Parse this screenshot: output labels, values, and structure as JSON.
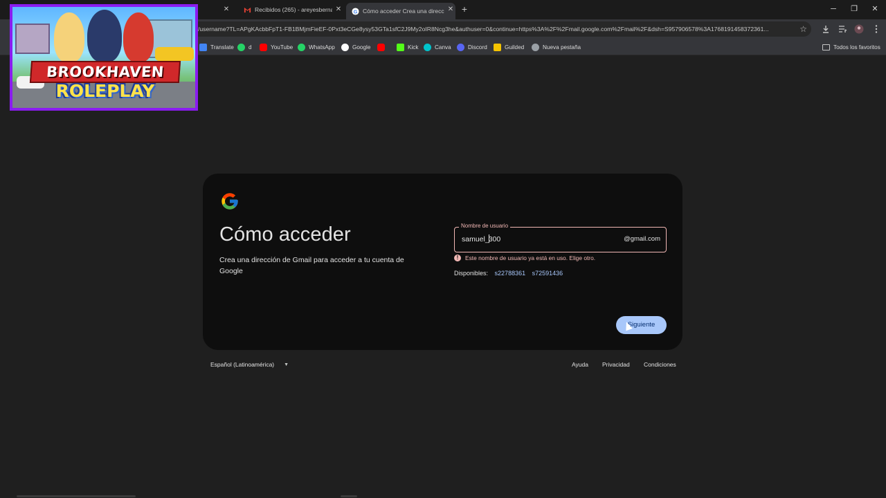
{
  "browser": {
    "tabs": [
      {
        "title": "",
        "active": false
      },
      {
        "title": "Recibidos (265) - areyesbernan",
        "active": false,
        "icon": "gmail-icon"
      },
      {
        "title": "Cómo acceder Crea una direcci",
        "active": true,
        "icon": "google-icon"
      }
    ],
    "url": "/username?TL=APgKAcbbFpT1-FB1BMjmFieEF-0Pxt3eCGe8ysy53GTa1sfC2J9My2oIR8Ncg3he&authuser=0&continue=https%3A%2F%2Fmail.google.com%2Fmail%2F&dsh=S957906578%3A1768191458372361...",
    "bookmarks": [
      {
        "label": "Translate",
        "icon": "translate-icon",
        "color": "#4285f4"
      },
      {
        "label": "d",
        "icon": "whatsapp-icon",
        "color": "#25d366"
      },
      {
        "label": "YouTube",
        "icon": "youtube-icon",
        "color": "#ff0000"
      },
      {
        "label": "WhatsApp",
        "icon": "whatsapp-icon",
        "color": "#25d366"
      },
      {
        "label": "Google",
        "icon": "google-icon",
        "color": "#4285f4"
      },
      {
        "label": "",
        "icon": "youtube-icon",
        "color": "#ff0000"
      },
      {
        "label": "Kick",
        "icon": "kick-icon",
        "color": "#53fc18"
      },
      {
        "label": "Canva",
        "icon": "canva-icon",
        "color": "#00c4cc"
      },
      {
        "label": "Discord",
        "icon": "discord-icon",
        "color": "#5865f2"
      },
      {
        "label": "Guilded",
        "icon": "guilded-icon",
        "color": "#f5c400"
      },
      {
        "label": "Nueva pestaña",
        "icon": "globe-icon",
        "color": "#9aa0a6"
      }
    ],
    "all_bookmarks": "Todos los favoritos"
  },
  "overlay": {
    "title_line1": "BROOKHAVEN",
    "title_line2": "ROLEPLAY"
  },
  "card": {
    "heading": "Cómo acceder",
    "subtext": "Crea una dirección de Gmail para acceder a tu cuenta de Google",
    "field_label": "Nombre de usuario",
    "field_value_before": "samuel_",
    "field_value_after": "300",
    "field_suffix": "@gmail.com",
    "error": "Este nombre de usuario ya está en uso. Elige otro.",
    "available_label": "Disponibles:",
    "suggestions": [
      "s22788361",
      "s72591436"
    ],
    "next_button": "Siguiente"
  },
  "footer": {
    "language": "Español (Latinoamérica)",
    "links": [
      "Ayuda",
      "Privacidad",
      "Condiciones"
    ]
  },
  "colors": {
    "accent": "#a8c7fa",
    "error": "#f2b8b5",
    "card_bg": "#0e0e0e",
    "page_bg": "#1f1f1f"
  }
}
